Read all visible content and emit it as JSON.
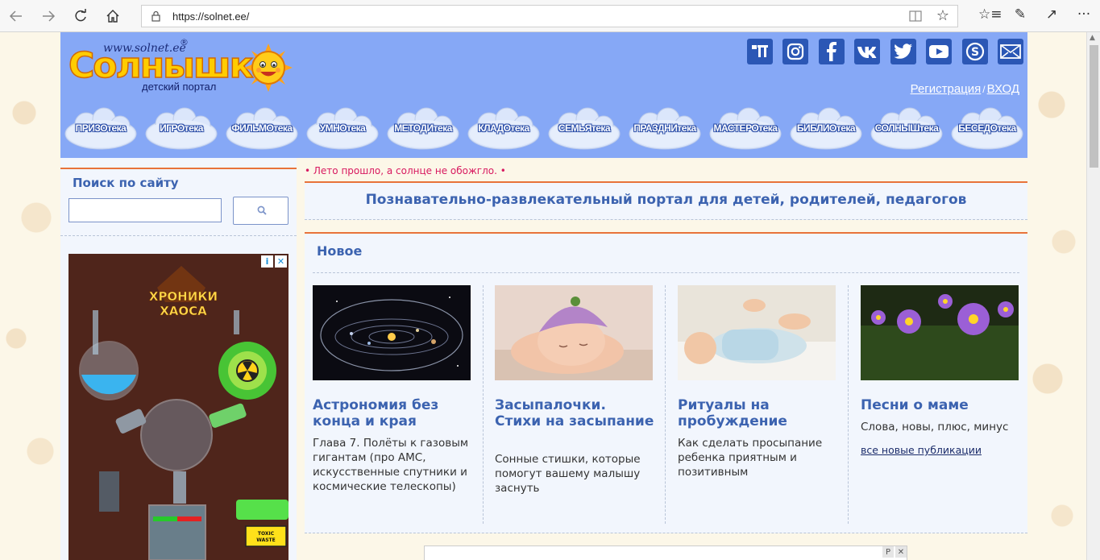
{
  "browser": {
    "url": "https://solnet.ee/",
    "icons": [
      "back-icon",
      "forward-icon",
      "reload-icon",
      "home-icon",
      "lock-icon",
      "reading-view-icon",
      "favorite-star-icon",
      "favorites-list-icon",
      "pen-icon",
      "share-icon",
      "more-icon"
    ]
  },
  "header": {
    "logo_www": "www.solnet.ee",
    "logo_reg": "®",
    "logo_name": "Солнышк",
    "logo_sub": "детский портал",
    "social": [
      "sitemap-icon",
      "instagram-icon",
      "facebook-icon",
      "vk-icon",
      "twitter-icon",
      "youtube-icon",
      "skype-icon",
      "email-icon"
    ],
    "register_label": "Регистрация",
    "auth_sep": "/",
    "login_label": "ВХОД",
    "nav": [
      "ПРИЗОтека",
      "ИГРОтека",
      "ФИЛЬМОтека",
      "УМНОтека",
      "МЕТОДИтека",
      "КЛАДОтека",
      "СЕМЬЯтека",
      "ПРАЗДНИтека",
      "МАСТЕРОтека",
      "БИБЛИОтека",
      "СОЛНЫШтека",
      "БЕСЕДОтека"
    ]
  },
  "sidebar": {
    "search_title": "Поиск по сайту",
    "search_value": "",
    "ad": {
      "game_title_line1": "ХРОНИКИ",
      "game_title_line2": "ХАОСА",
      "badge": "TOXIC WASTE"
    }
  },
  "main": {
    "ticker": "• Лето прошло, а солнце не обожгло. •",
    "tagline": "Познавательно-развлекательный портал для детей, родителей, педагогов",
    "new_title": "Новое",
    "cards": [
      {
        "title": "Астрономия без конца и края",
        "desc": "Глава 7. Полёты к газовым гигантам (про АМС, искусственные спутники и космические телескопы)"
      },
      {
        "title": "Засыпалочки. Стихи на засыпание",
        "desc": "Сонные стишки, которые помогут вашему малышу заснуть"
      },
      {
        "title": "Ритуалы на пробуждение",
        "desc": "Как сделать просыпание ребенка приятным и позитивным"
      },
      {
        "title": "Песни о маме",
        "desc": "Слова, новы, плюс, минус"
      }
    ],
    "all_link": "все новые публикации"
  },
  "bottom_ad": {
    "ctrl_p": "P",
    "ctrl_x": "✕"
  }
}
